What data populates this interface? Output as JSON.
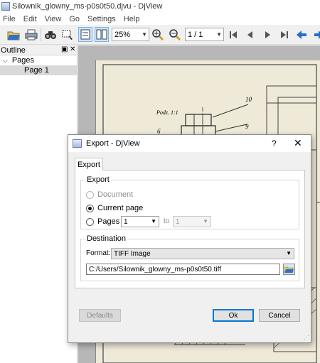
{
  "window": {
    "title": "Silownik_glowny_ms-p0s0t50.djvu - DjView"
  },
  "menu": [
    "File",
    "Edit",
    "View",
    "Go",
    "Settings",
    "Help"
  ],
  "toolbar": {
    "zoom": "25%",
    "page": "1 / 1"
  },
  "outline": {
    "title": "Outline",
    "items": [
      {
        "label": "Pages",
        "expanded": true
      },
      {
        "label": "Page 1",
        "selected": true
      }
    ]
  },
  "drawing_labels": {
    "scale": "Podz. 1:1",
    "n10": "10",
    "n9": "9",
    "n6": "6"
  },
  "dialog": {
    "title": "Export - DjView",
    "help": "?",
    "close": "✕",
    "tab": "Export",
    "export_group": {
      "label": "Export",
      "document": "Document",
      "current_page": "Current page",
      "pages": "Pages",
      "pages_from": "1",
      "to": "to",
      "pages_to": "1"
    },
    "destination_group": {
      "label": "Destination",
      "format_label": "Format:",
      "format_value": "TIFF Image",
      "path": "C:/Users/Silownik_glowny_ms-p0s0t50.tiff"
    },
    "buttons": {
      "defaults": "Defaults",
      "ok": "Ok",
      "cancel": "Cancel"
    }
  }
}
